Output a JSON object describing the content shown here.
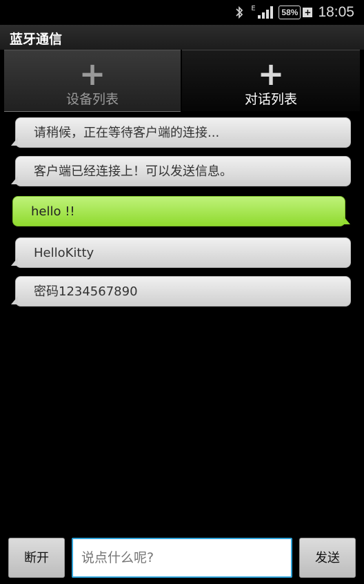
{
  "status_bar": {
    "bluetooth_icon": "bluetooth-icon",
    "network_type": "E",
    "signal_icon": "signal-icon",
    "battery_percent": "58%",
    "battery_charging_icon": "plus-icon",
    "time": "18:05"
  },
  "app": {
    "title": "蓝牙通信"
  },
  "tabs": [
    {
      "label": "设备列表",
      "icon": "plus-icon",
      "selected": false
    },
    {
      "label": "对话列表",
      "icon": "plus-icon",
      "selected": true
    }
  ],
  "messages": [
    {
      "text": "请稍候，正在等待客户端的连接...",
      "type": "received"
    },
    {
      "text": "客户端已经连接上！可以发送信息。",
      "type": "received"
    },
    {
      "text": "hello !!",
      "type": "sent"
    },
    {
      "text": "HelloKitty",
      "type": "received"
    },
    {
      "text": "密码1234567890",
      "type": "received"
    }
  ],
  "bottom": {
    "disconnect_label": "断开",
    "input_value": "",
    "input_placeholder": "说点什么呢?",
    "send_label": "发送"
  },
  "colors": {
    "received_bubble": "#e6e6e6",
    "sent_bubble": "#a6e24a",
    "input_border": "#2fa3d9"
  }
}
